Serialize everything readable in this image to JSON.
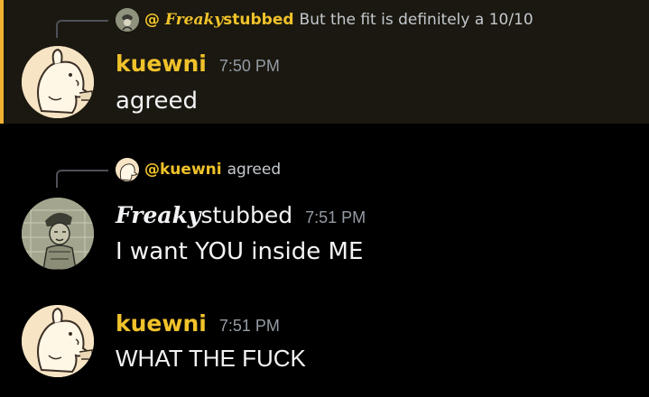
{
  "messages": [
    {
      "reply": {
        "mention": "@",
        "mention_fancy": "Freaky",
        "mention_rest": "stubbed",
        "text": "But the fit is definitely a 10/10"
      },
      "username": "kuewni",
      "timestamp": "7:50 PM",
      "content": "agreed"
    },
    {
      "reply": {
        "mention": "@kuewni",
        "text": "agreed"
      },
      "username_fancy": "Freaky",
      "username_rest": "stubbed",
      "timestamp": "7:51 PM",
      "content": "I want YOU inside ME"
    },
    {
      "username": "kuewni",
      "timestamp": "7:51 PM",
      "content": "WHAT THE FUCK"
    }
  ],
  "colors": {
    "background": "#000000",
    "highlight_bg": "#1a1810",
    "highlight_bar": "#f0b232",
    "username_yellow": "#f0c22b",
    "timestamp_gray": "#949ba4",
    "text_white": "#f2f3f5"
  }
}
